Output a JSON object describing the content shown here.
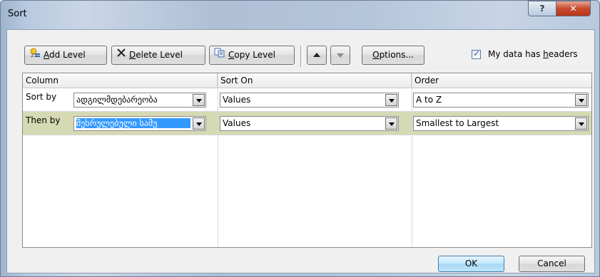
{
  "window": {
    "title": "Sort",
    "help_glyph": "?",
    "close_glyph": "✕"
  },
  "toolbar": {
    "add_level": {
      "accel": "A",
      "rest": "dd Level"
    },
    "delete_level": {
      "accel": "D",
      "rest": "elete Level"
    },
    "copy_level": {
      "accel": "C",
      "rest": "opy Level"
    },
    "options": {
      "accel": "O",
      "rest": "ptions..."
    },
    "headers_checkbox": {
      "checked": true,
      "label_pre": "My data has ",
      "accel": "h",
      "label_post": "eaders"
    }
  },
  "grid": {
    "headers": {
      "column": "Column",
      "sort_on": "Sort On",
      "order": "Order"
    },
    "rows": [
      {
        "label": "Sort by",
        "column": "ადგილმდებარეობა",
        "sort_on": "Values",
        "order": "A to Z"
      },
      {
        "label": "Then by",
        "column": "შესრულებული სამუ",
        "sort_on": "Values",
        "order": "Smallest to Largest"
      }
    ]
  },
  "buttons": {
    "ok": "OK",
    "cancel": "Cancel"
  }
}
